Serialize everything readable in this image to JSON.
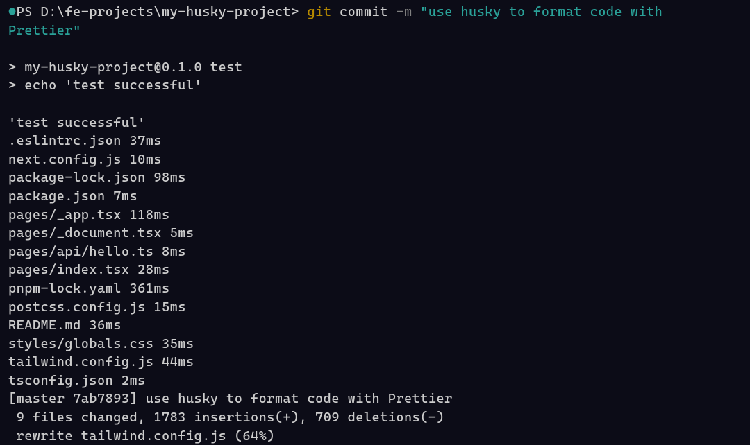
{
  "prompt": {
    "marker": "●",
    "prefix": "PS ",
    "path": "D:\\fe-projects\\my-husky-project",
    "sep": "> ",
    "git": "git",
    "commit": " commit ",
    "flag": "-m",
    "msg_part1": " \"use husky to format code with ",
    "msg_part2": "Prettier\""
  },
  "output_lines": [
    "",
    "> my-husky-project@0.1.0 test",
    "> echo 'test successful'",
    "",
    "'test successful'",
    ".eslintrc.json 37ms",
    "next.config.js 10ms",
    "package-lock.json 98ms",
    "package.json 7ms",
    "pages/_app.tsx 118ms",
    "pages/_document.tsx 5ms",
    "pages/api/hello.ts 8ms",
    "pages/index.tsx 28ms",
    "pnpm-lock.yaml 361ms",
    "postcss.config.js 15ms",
    "README.md 36ms",
    "styles/globals.css 35ms",
    "tailwind.config.js 44ms",
    "tsconfig.json 2ms",
    "[master 7ab7893] use husky to format code with Prettier",
    " 9 files changed, 1783 insertions(+), 709 deletions(-)",
    " rewrite tailwind.config.js (64%)"
  ]
}
